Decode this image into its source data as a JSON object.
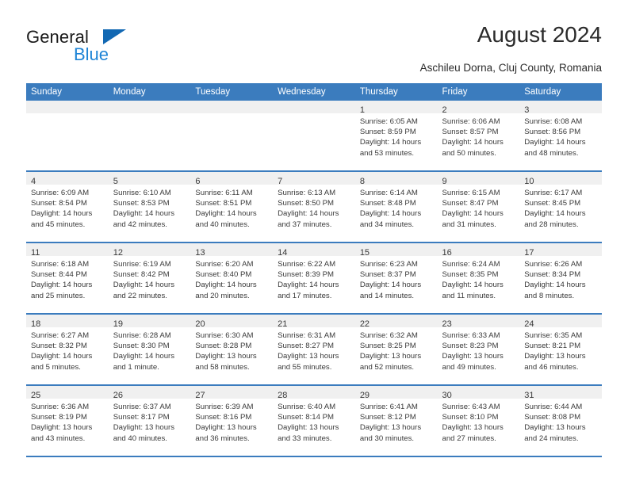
{
  "brand": {
    "name_part1": "General",
    "name_part2": "Blue",
    "triangle_color": "#1268b3",
    "blue_color": "#1e84d6"
  },
  "header": {
    "title": "August 2024",
    "subtitle": "Aschileu Dorna, Cluj County, Romania"
  },
  "calendar": {
    "header_bg": "#3b7cbe",
    "daynum_bg": "#f0f0f0",
    "weekdays": [
      "Sunday",
      "Monday",
      "Tuesday",
      "Wednesday",
      "Thursday",
      "Friday",
      "Saturday"
    ],
    "weeks": [
      [
        {
          "day": "",
          "sunrise": "",
          "sunset": "",
          "daylight": ""
        },
        {
          "day": "",
          "sunrise": "",
          "sunset": "",
          "daylight": ""
        },
        {
          "day": "",
          "sunrise": "",
          "sunset": "",
          "daylight": ""
        },
        {
          "day": "",
          "sunrise": "",
          "sunset": "",
          "daylight": ""
        },
        {
          "day": "1",
          "sunrise": "Sunrise: 6:05 AM",
          "sunset": "Sunset: 8:59 PM",
          "daylight": "Daylight: 14 hours and 53 minutes."
        },
        {
          "day": "2",
          "sunrise": "Sunrise: 6:06 AM",
          "sunset": "Sunset: 8:57 PM",
          "daylight": "Daylight: 14 hours and 50 minutes."
        },
        {
          "day": "3",
          "sunrise": "Sunrise: 6:08 AM",
          "sunset": "Sunset: 8:56 PM",
          "daylight": "Daylight: 14 hours and 48 minutes."
        }
      ],
      [
        {
          "day": "4",
          "sunrise": "Sunrise: 6:09 AM",
          "sunset": "Sunset: 8:54 PM",
          "daylight": "Daylight: 14 hours and 45 minutes."
        },
        {
          "day": "5",
          "sunrise": "Sunrise: 6:10 AM",
          "sunset": "Sunset: 8:53 PM",
          "daylight": "Daylight: 14 hours and 42 minutes."
        },
        {
          "day": "6",
          "sunrise": "Sunrise: 6:11 AM",
          "sunset": "Sunset: 8:51 PM",
          "daylight": "Daylight: 14 hours and 40 minutes."
        },
        {
          "day": "7",
          "sunrise": "Sunrise: 6:13 AM",
          "sunset": "Sunset: 8:50 PM",
          "daylight": "Daylight: 14 hours and 37 minutes."
        },
        {
          "day": "8",
          "sunrise": "Sunrise: 6:14 AM",
          "sunset": "Sunset: 8:48 PM",
          "daylight": "Daylight: 14 hours and 34 minutes."
        },
        {
          "day": "9",
          "sunrise": "Sunrise: 6:15 AM",
          "sunset": "Sunset: 8:47 PM",
          "daylight": "Daylight: 14 hours and 31 minutes."
        },
        {
          "day": "10",
          "sunrise": "Sunrise: 6:17 AM",
          "sunset": "Sunset: 8:45 PM",
          "daylight": "Daylight: 14 hours and 28 minutes."
        }
      ],
      [
        {
          "day": "11",
          "sunrise": "Sunrise: 6:18 AM",
          "sunset": "Sunset: 8:44 PM",
          "daylight": "Daylight: 14 hours and 25 minutes."
        },
        {
          "day": "12",
          "sunrise": "Sunrise: 6:19 AM",
          "sunset": "Sunset: 8:42 PM",
          "daylight": "Daylight: 14 hours and 22 minutes."
        },
        {
          "day": "13",
          "sunrise": "Sunrise: 6:20 AM",
          "sunset": "Sunset: 8:40 PM",
          "daylight": "Daylight: 14 hours and 20 minutes."
        },
        {
          "day": "14",
          "sunrise": "Sunrise: 6:22 AM",
          "sunset": "Sunset: 8:39 PM",
          "daylight": "Daylight: 14 hours and 17 minutes."
        },
        {
          "day": "15",
          "sunrise": "Sunrise: 6:23 AM",
          "sunset": "Sunset: 8:37 PM",
          "daylight": "Daylight: 14 hours and 14 minutes."
        },
        {
          "day": "16",
          "sunrise": "Sunrise: 6:24 AM",
          "sunset": "Sunset: 8:35 PM",
          "daylight": "Daylight: 14 hours and 11 minutes."
        },
        {
          "day": "17",
          "sunrise": "Sunrise: 6:26 AM",
          "sunset": "Sunset: 8:34 PM",
          "daylight": "Daylight: 14 hours and 8 minutes."
        }
      ],
      [
        {
          "day": "18",
          "sunrise": "Sunrise: 6:27 AM",
          "sunset": "Sunset: 8:32 PM",
          "daylight": "Daylight: 14 hours and 5 minutes."
        },
        {
          "day": "19",
          "sunrise": "Sunrise: 6:28 AM",
          "sunset": "Sunset: 8:30 PM",
          "daylight": "Daylight: 14 hours and 1 minute."
        },
        {
          "day": "20",
          "sunrise": "Sunrise: 6:30 AM",
          "sunset": "Sunset: 8:28 PM",
          "daylight": "Daylight: 13 hours and 58 minutes."
        },
        {
          "day": "21",
          "sunrise": "Sunrise: 6:31 AM",
          "sunset": "Sunset: 8:27 PM",
          "daylight": "Daylight: 13 hours and 55 minutes."
        },
        {
          "day": "22",
          "sunrise": "Sunrise: 6:32 AM",
          "sunset": "Sunset: 8:25 PM",
          "daylight": "Daylight: 13 hours and 52 minutes."
        },
        {
          "day": "23",
          "sunrise": "Sunrise: 6:33 AM",
          "sunset": "Sunset: 8:23 PM",
          "daylight": "Daylight: 13 hours and 49 minutes."
        },
        {
          "day": "24",
          "sunrise": "Sunrise: 6:35 AM",
          "sunset": "Sunset: 8:21 PM",
          "daylight": "Daylight: 13 hours and 46 minutes."
        }
      ],
      [
        {
          "day": "25",
          "sunrise": "Sunrise: 6:36 AM",
          "sunset": "Sunset: 8:19 PM",
          "daylight": "Daylight: 13 hours and 43 minutes."
        },
        {
          "day": "26",
          "sunrise": "Sunrise: 6:37 AM",
          "sunset": "Sunset: 8:17 PM",
          "daylight": "Daylight: 13 hours and 40 minutes."
        },
        {
          "day": "27",
          "sunrise": "Sunrise: 6:39 AM",
          "sunset": "Sunset: 8:16 PM",
          "daylight": "Daylight: 13 hours and 36 minutes."
        },
        {
          "day": "28",
          "sunrise": "Sunrise: 6:40 AM",
          "sunset": "Sunset: 8:14 PM",
          "daylight": "Daylight: 13 hours and 33 minutes."
        },
        {
          "day": "29",
          "sunrise": "Sunrise: 6:41 AM",
          "sunset": "Sunset: 8:12 PM",
          "daylight": "Daylight: 13 hours and 30 minutes."
        },
        {
          "day": "30",
          "sunrise": "Sunrise: 6:43 AM",
          "sunset": "Sunset: 8:10 PM",
          "daylight": "Daylight: 13 hours and 27 minutes."
        },
        {
          "day": "31",
          "sunrise": "Sunrise: 6:44 AM",
          "sunset": "Sunset: 8:08 PM",
          "daylight": "Daylight: 13 hours and 24 minutes."
        }
      ]
    ]
  }
}
